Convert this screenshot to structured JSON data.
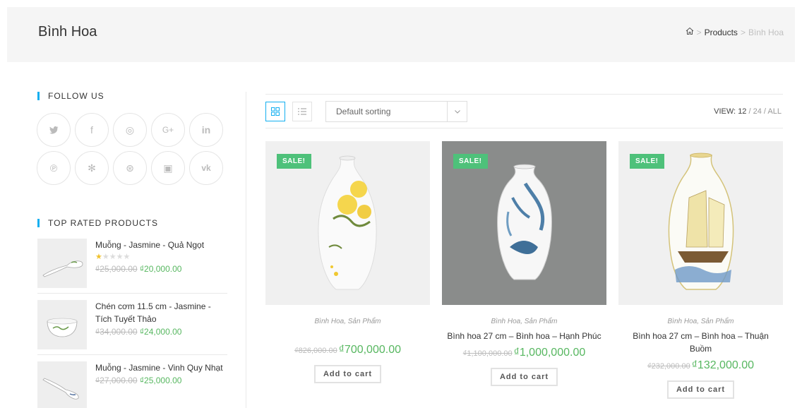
{
  "header": {
    "title": "Bình Hoa",
    "breadcrumb": {
      "home_icon": "home-icon",
      "separator": ">",
      "products": "Products",
      "current": "Bình Hoa"
    }
  },
  "sidebar": {
    "follow_title": "FOLLOW US",
    "social": [
      {
        "name": "twitter",
        "glyph": "🐦"
      },
      {
        "name": "facebook",
        "glyph": "f"
      },
      {
        "name": "instagram",
        "glyph": "◎"
      },
      {
        "name": "google-plus",
        "glyph": "G+"
      },
      {
        "name": "linkedin",
        "glyph": "in"
      },
      {
        "name": "pinterest",
        "glyph": "℗"
      },
      {
        "name": "yelp",
        "glyph": "✻"
      },
      {
        "name": "dribbble",
        "glyph": "⊛"
      },
      {
        "name": "flickr",
        "glyph": "▣"
      },
      {
        "name": "vk",
        "glyph": "vk"
      }
    ],
    "top_title": "TOP RATED PRODUCTS",
    "top_products": [
      {
        "name": "Muỗng - Jasmine - Quả Ngọt",
        "rating": 1,
        "old_price": "₫25,000.00",
        "price": "₫20,000.00",
        "thumb": "spoon"
      },
      {
        "name": "Chén cơm 11.5 cm - Jasmine - Tích Tuyết Thảo",
        "rating": 0,
        "old_price": "₫34,000.00",
        "price": "₫24,000.00",
        "thumb": "bowl"
      },
      {
        "name": "Muỗng - Jasmine - Vinh Quy Nhạt",
        "rating": 0,
        "old_price": "₫27,000.00",
        "price": "₫25,000.00",
        "thumb": "spoon"
      }
    ]
  },
  "toolbar": {
    "grid_icon": "grid-view-icon",
    "list_icon": "list-view-icon",
    "sort_label": "Default sorting",
    "view_label": "VIEW:",
    "view_12": "12",
    "view_sep": " / ",
    "view_24": "24",
    "view_all": "ALL"
  },
  "products": [
    {
      "sale": "SALE!",
      "cats": "Bình Hoa, Sản Phẩm",
      "title": "",
      "old_price": "₫826,000.00",
      "price": "₫700,000.00",
      "cart": "Add to cart"
    },
    {
      "sale": "SALE!",
      "cats": "Bình Hoa, Sản Phẩm",
      "title": "Bình hoa 27 cm – Bình hoa – Hạnh Phúc",
      "old_price": "₫1,100,000.00",
      "price": "₫1,000,000.00",
      "cart": "Add to cart"
    },
    {
      "sale": "SALE!",
      "cats": "Bình Hoa, Sản Phẩm",
      "title": "Bình hoa 27 cm – Bình hoa – Thuận Buồm",
      "old_price": "₫232,000.00",
      "price": "₫132,000.00",
      "cart": "Add to cart"
    }
  ],
  "colors": {
    "accent": "#13aff0",
    "sale": "#4ec17a",
    "price": "#57b760",
    "star": "#f0c12c"
  }
}
